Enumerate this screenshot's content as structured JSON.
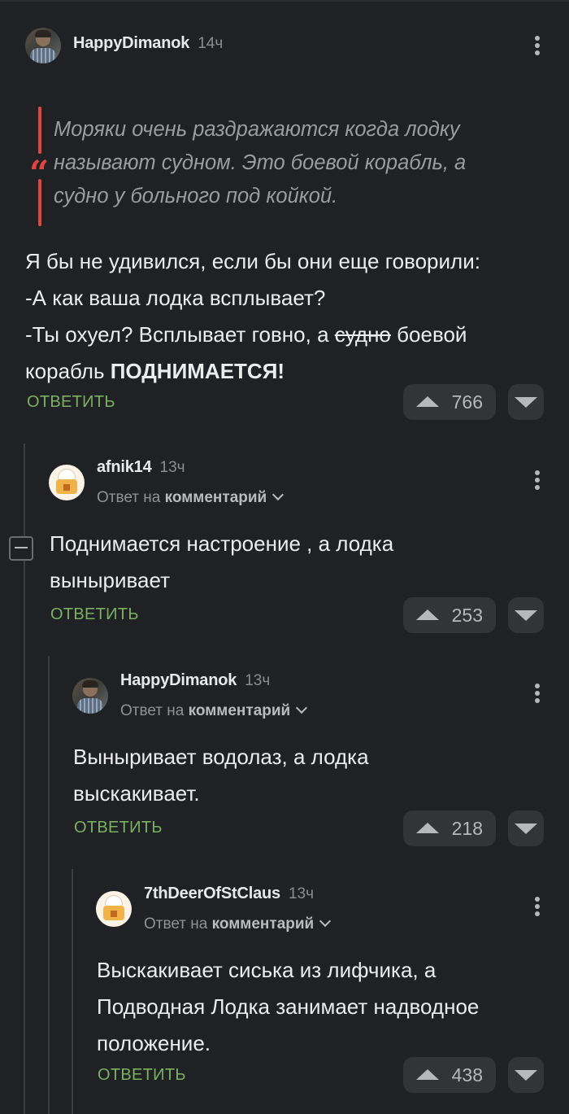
{
  "comments": [
    {
      "username": "HappyDimanok",
      "time": "14ч",
      "quote": [
        "Моряки очень раздражаются когда лодку",
        "называют судном. Это боевой корабль, а",
        "судно у больного под койкой."
      ],
      "quote_mark": "“",
      "lines": {
        "l1": "Я бы не удивился, если бы они еще говорили:",
        "l2": "-А как ваша лодка всплывает?",
        "l3a": "-Ты охуел? Всплывает говно, а ",
        "l3strike": "судно",
        "l3b": " боевой",
        "l4a": "корабль ",
        "l4bold": "ПОДНИМАЕТСЯ!"
      },
      "reply_label": "ОТВЕТИТЬ",
      "votes": "766"
    },
    {
      "username": "afnik14",
      "time": "13ч",
      "reply_to_prefix": "Ответ на ",
      "reply_to_target": "комментарий",
      "text": [
        "Поднимается настроение , а лодка",
        "выныривает"
      ],
      "reply_label": "ОТВЕТИТЬ",
      "votes": "253"
    },
    {
      "username": "HappyDimanok",
      "time": "13ч",
      "reply_to_prefix": "Ответ на ",
      "reply_to_target": "комментарий",
      "text": [
        "Выныривает водолаз, а лодка",
        "выскакивает."
      ],
      "reply_label": "ОТВЕТИТЬ",
      "votes": "218"
    },
    {
      "username": "7thDeerOfStClaus",
      "time": "13ч",
      "reply_to_prefix": "Ответ на ",
      "reply_to_target": "комментарий",
      "text": [
        "Выскакивает сиська из лифчика, а",
        "Подводная Лодка занимает надводное",
        "положение."
      ],
      "reply_label": "ОТВЕТИТЬ",
      "votes": "438"
    }
  ],
  "icons": {
    "more": "more-vertical-icon",
    "upvote": "arrow-up-icon",
    "downvote": "arrow-down-icon",
    "collapse": "minus-icon",
    "chevron": "chevron-down-icon"
  },
  "colors": {
    "background": "#1f2125",
    "accent_red": "#e0463d",
    "reply_green": "#7ab15f",
    "vote_bg": "#323438"
  }
}
